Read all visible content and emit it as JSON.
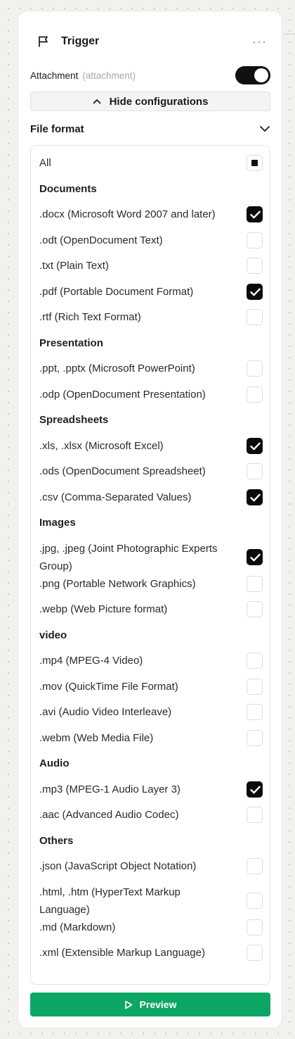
{
  "node": {
    "title": "Trigger",
    "icon": "flag-icon",
    "more_icon": "more-horizontal-icon",
    "more_label": "···"
  },
  "attachment": {
    "label": "Attachment",
    "tag": "(attachment)",
    "toggle_on": true
  },
  "hide_configurations": {
    "label": "Hide configurations",
    "icon": "chevron-up-icon"
  },
  "file_format": {
    "label": "File format",
    "icon": "chevron-down-icon"
  },
  "items": [
    {
      "kind": "option",
      "label": "All",
      "state": "partial"
    },
    {
      "kind": "group",
      "label": "Documents"
    },
    {
      "kind": "option",
      "label": ".docx (Microsoft Word 2007 and later)",
      "state": "checked"
    },
    {
      "kind": "option",
      "label": ".odt (OpenDocument Text)",
      "state": "unchecked"
    },
    {
      "kind": "option",
      "label": ".txt (Plain Text)",
      "state": "unchecked"
    },
    {
      "kind": "option",
      "label": ".pdf (Portable Document Format)",
      "state": "checked"
    },
    {
      "kind": "option",
      "label": ".rtf (Rich Text Format)",
      "state": "unchecked"
    },
    {
      "kind": "group",
      "label": "Presentation"
    },
    {
      "kind": "option",
      "label": ".ppt, .pptx (Microsoft PowerPoint)",
      "state": "unchecked"
    },
    {
      "kind": "option",
      "label": ".odp (OpenDocument Presentation)",
      "state": "unchecked"
    },
    {
      "kind": "group",
      "label": "Spreadsheets"
    },
    {
      "kind": "option",
      "label": ".xls, .xlsx (Microsoft Excel)",
      "state": "checked"
    },
    {
      "kind": "option",
      "label": ".ods (OpenDocument Spreadsheet)",
      "state": "unchecked"
    },
    {
      "kind": "option",
      "label": ".csv (Comma-Separated Values)",
      "state": "checked"
    },
    {
      "kind": "group",
      "label": "Images"
    },
    {
      "kind": "option",
      "label": ".jpg, .jpeg (Joint Photographic Experts Group)",
      "state": "checked",
      "lines": [
        ".jpg, .jpeg (Joint Photographic Experts",
        "Group)"
      ]
    },
    {
      "kind": "option",
      "label": ".png (Portable Network Graphics)",
      "state": "unchecked"
    },
    {
      "kind": "option",
      "label": ".webp (Web Picture format)",
      "state": "unchecked"
    },
    {
      "kind": "group",
      "label": "video"
    },
    {
      "kind": "option",
      "label": ".mp4 (MPEG-4 Video)",
      "state": "unchecked"
    },
    {
      "kind": "option",
      "label": ".mov (QuickTime File Format)",
      "state": "unchecked"
    },
    {
      "kind": "option",
      "label": ".avi (Audio Video Interleave)",
      "state": "unchecked"
    },
    {
      "kind": "option",
      "label": ".webm (Web Media File)",
      "state": "unchecked"
    },
    {
      "kind": "group",
      "label": "Audio"
    },
    {
      "kind": "option",
      "label": ".mp3 (MPEG-1 Audio Layer 3)",
      "state": "checked"
    },
    {
      "kind": "option",
      "label": ".aac (Advanced Audio Codec)",
      "state": "unchecked"
    },
    {
      "kind": "group",
      "label": "Others"
    },
    {
      "kind": "option",
      "label": ".json (JavaScript Object Notation)",
      "state": "unchecked"
    },
    {
      "kind": "option",
      "label": ".html, .htm (HyperText Markup Language)",
      "state": "unchecked",
      "lines": [
        ".html, .htm (HyperText Markup",
        "Language)"
      ]
    },
    {
      "kind": "option",
      "label": ".md (Markdown)",
      "state": "unchecked"
    },
    {
      "kind": "option",
      "label": ".xml (Extensible Markup Language)",
      "state": "unchecked"
    }
  ],
  "preview": {
    "label": "Preview",
    "icon": "play-icon",
    "color": "#0ca765"
  }
}
